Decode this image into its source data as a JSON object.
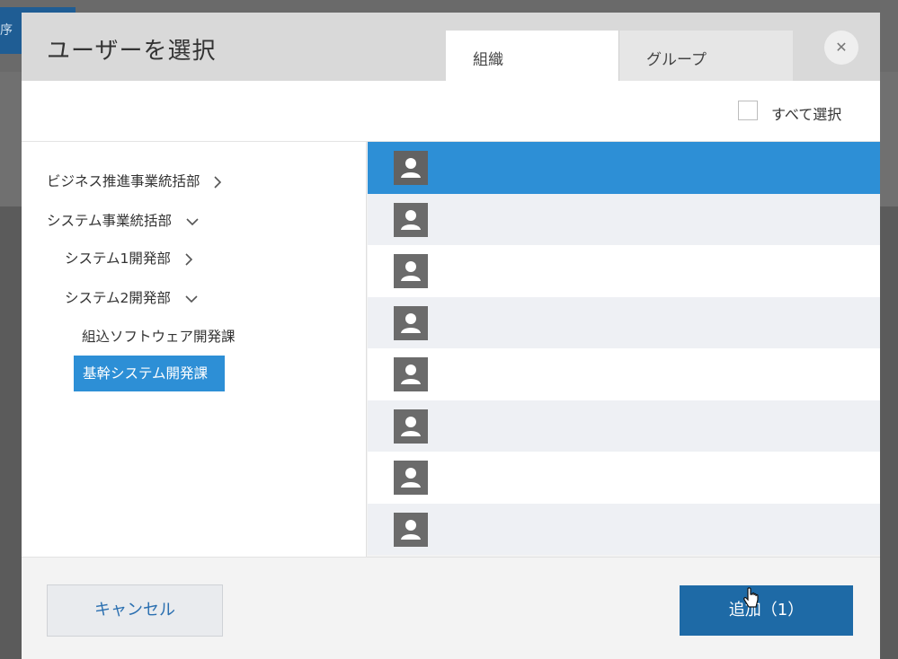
{
  "background": {
    "chip_text": "序"
  },
  "dialog": {
    "title": "ユーザーを選択",
    "tabs": [
      {
        "label": "組織",
        "active": true
      },
      {
        "label": "グループ",
        "active": false
      }
    ],
    "close_icon": "close-icon"
  },
  "select_all": {
    "label": "すべて選択",
    "checked": false
  },
  "tree": {
    "items": [
      {
        "label": "ビジネス推進事業統括部",
        "chevron": "right"
      },
      {
        "label": "システム事業統括部",
        "chevron": "down"
      },
      {
        "label": "システム1開発部",
        "chevron": "right"
      },
      {
        "label": "システム2開発部",
        "chevron": "down"
      },
      {
        "label": "組込ソフトウェア開発課",
        "chevron": ""
      },
      {
        "label": "基幹システム開発課",
        "selected": true
      }
    ]
  },
  "users": {
    "count": 8,
    "selected_index": 0,
    "icon": "user-avatar-icon"
  },
  "footer": {
    "cancel_label": "キャンセル",
    "add_label": "追加（1）"
  },
  "colors": {
    "accent": "#2d8fd6",
    "primary_button": "#1e6aa6",
    "header": "#d9d9d9"
  }
}
